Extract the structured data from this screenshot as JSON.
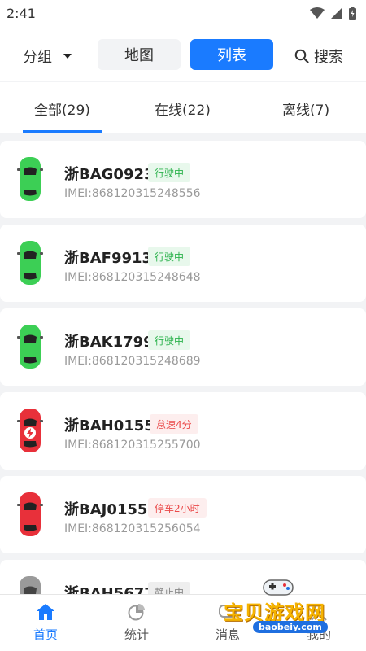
{
  "status_bar": {
    "time": "2:41"
  },
  "header": {
    "group_label": "分组",
    "map_label": "地图",
    "list_label": "列表",
    "search_label": "搜索"
  },
  "tabs": {
    "all": "全部(29)",
    "online": "在线(22)",
    "offline": "离线(7)"
  },
  "vehicles": [
    {
      "plate": "浙BAG0923",
      "status": "行驶中",
      "imei": "IMEI:868120315248556",
      "status_color": "#2bb24c",
      "car_color": "#3ccf55"
    },
    {
      "plate": "浙BAF9913",
      "status": "行驶中",
      "imei": "IMEI:868120315248648",
      "status_color": "#2bb24c",
      "car_color": "#3ccf55"
    },
    {
      "plate": "浙BAK1799",
      "status": "行驶中",
      "imei": "IMEI:868120315248689",
      "status_color": "#2bb24c",
      "car_color": "#3ccf55"
    },
    {
      "plate": "浙BAH0155",
      "status": "怠速4分",
      "imei": "IMEI:868120315255700",
      "status_color": "#ea4a4a",
      "car_color": "#e8303a"
    },
    {
      "plate": "浙BAJ0155",
      "status": "停车2小时",
      "imei": "IMEI:868120315256054",
      "status_color": "#ea4a4a",
      "car_color": "#e8303a"
    },
    {
      "plate": "浙BAH5677",
      "status": "静止中",
      "imei": "",
      "status_color": "#888888",
      "car_color": "#9a9a9a"
    }
  ],
  "bottom_nav": {
    "home": "首页",
    "stats": "统计",
    "messages": "消息",
    "mine": "我的"
  },
  "watermark": {
    "title": "宝贝游戏网",
    "url": "baobeiy.com"
  },
  "colors": {
    "accent": "#1a7bff",
    "online": "#2bb24c",
    "alert": "#ea4a4a"
  }
}
